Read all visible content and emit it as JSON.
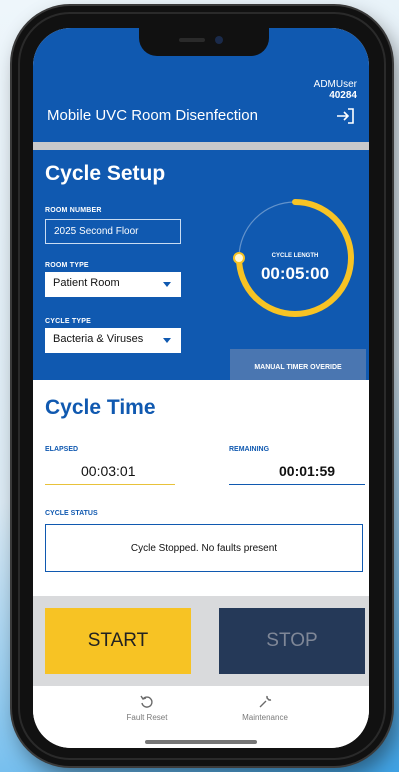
{
  "header": {
    "user_name": "ADMUser",
    "user_id": "40284",
    "title": "Mobile UVC Room Disenfection",
    "logout_icon": "logout-arrow-icon"
  },
  "setup": {
    "title": "Cycle Setup",
    "room_number_label": "ROOM NUMBER",
    "room_number_value": "2025 Second Floor",
    "room_type_label": "ROOM TYPE",
    "room_type_value": "Patient Room",
    "cycle_type_label": "CYCLE TYPE",
    "cycle_type_value": "Bacteria & Viruses",
    "cycle_length_label": "CYCLE LENGTH",
    "cycle_length_value": "00:05:00",
    "dial_progress": 0.75,
    "override_label": "MANUAL TIMER OVERIDE"
  },
  "cycle_time": {
    "title": "Cycle Time",
    "elapsed_label": "ELAPSED",
    "elapsed_value": "00:03:01",
    "remaining_label": "REMAINING",
    "remaining_value": "00:01:59",
    "status_label": "CYCLE STATUS",
    "status_value": "Cycle Stopped. No faults present"
  },
  "buttons": {
    "start_label": "START",
    "stop_label": "STOP"
  },
  "nav": {
    "fault_reset_label": "Fault Reset",
    "maintenance_label": "Maintenance"
  },
  "colors": {
    "primary_blue": "#1059b0",
    "accent_yellow": "#f7c324",
    "stop_navy": "#253958"
  }
}
